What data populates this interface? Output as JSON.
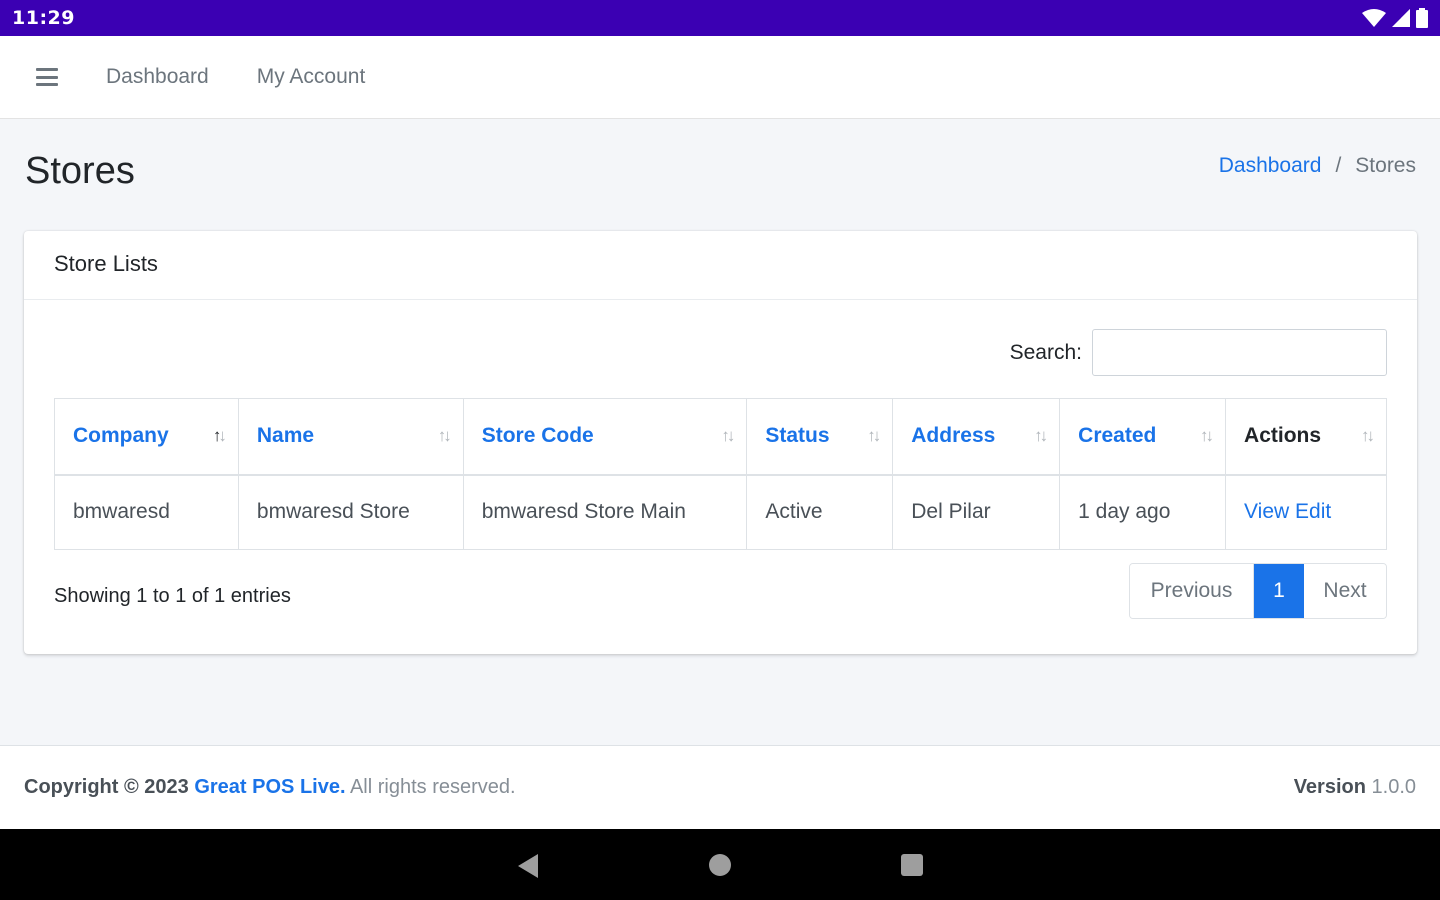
{
  "status_bar": {
    "time": "11:29"
  },
  "navbar": {
    "links": [
      "Dashboard",
      "My Account"
    ]
  },
  "page": {
    "title": "Stores"
  },
  "breadcrumb": {
    "parent": "Dashboard",
    "separator": "/",
    "current": "Stores"
  },
  "card": {
    "title": "Store Lists",
    "search_label": "Search:",
    "search_value": "",
    "columns": [
      "Company",
      "Name",
      "Store Code",
      "Status",
      "Address",
      "Created",
      "Actions"
    ],
    "rows": [
      {
        "company": "bmwaresd",
        "name": "bmwaresd Store",
        "store_code": "bmwaresd Store Main",
        "status": "Active",
        "address": "Del Pilar",
        "created": "1 day ago",
        "action_view": "View",
        "action_edit": "Edit"
      }
    ],
    "info": "Showing 1 to 1 of 1 entries",
    "pagination": {
      "previous": "Previous",
      "current": "1",
      "next": "Next"
    }
  },
  "footer": {
    "copyright_prefix": "Copyright © 2023",
    "brand": "Great POS Live.",
    "rights": "All rights reserved.",
    "version_label": "Version",
    "version_value": "1.0.0"
  },
  "colors": {
    "status_bar": "#3b00b3",
    "accent": "#1a73e8",
    "background": "#f4f6f9"
  },
  "icons": [
    "wifi-icon",
    "signal-icon",
    "battery-icon",
    "hamburger-menu-icon",
    "sort-icon",
    "back-icon",
    "home-icon",
    "recents-icon"
  ]
}
